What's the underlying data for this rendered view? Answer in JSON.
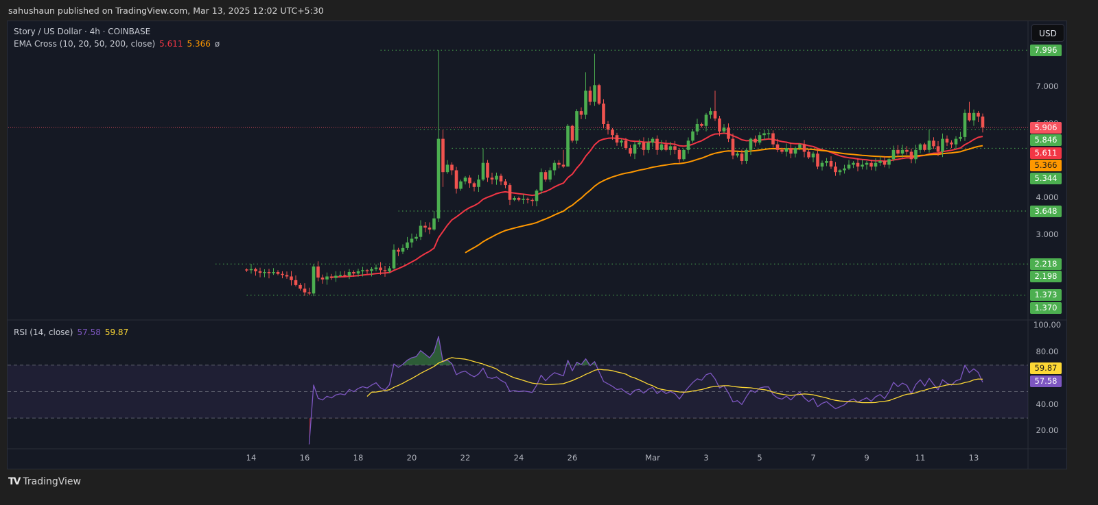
{
  "published": "sahushaun published on TradingView.com, Mar 13, 2025 12:02 UTC+5:30",
  "symbol_line": "Story / US Dollar · 4h · COINBASE",
  "ema_legend": {
    "name": "EMA Cross (10, 20, 50, 200, close)",
    "v1": "5.611",
    "v2": "5.366",
    "v3": "ø"
  },
  "rsi_legend": {
    "name": "RSI (14, close)",
    "rsi": "57.58",
    "ma": "59.87"
  },
  "currency_button": "USD",
  "footer_brand": "TradingView",
  "colors": {
    "up": "#4caf50",
    "down": "#f0534f",
    "ema_fast": "#f23645",
    "ema_slow": "#ff9800",
    "rsi": "#7e57c2",
    "rsi_ma": "#fdd835",
    "level": "#4caf50",
    "last_price": "#f7525f"
  },
  "chart_data": {
    "type": "candlestick",
    "timeframe": "4h",
    "closes": [
      2.05,
      2.08,
      2.02,
      1.98,
      2.0,
      1.97,
      2.0,
      1.95,
      1.92,
      1.88,
      1.78,
      1.65,
      1.55,
      1.45,
      1.42,
      2.15,
      1.85,
      1.8,
      1.88,
      1.84,
      1.9,
      1.92,
      1.9,
      2.0,
      1.96,
      2.02,
      2.05,
      2.03,
      2.08,
      2.12,
      2.05,
      2.02,
      2.1,
      2.6,
      2.55,
      2.65,
      2.8,
      2.9,
      2.95,
      3.25,
      3.2,
      3.15,
      3.45,
      5.6,
      4.7,
      4.9,
      4.75,
      4.25,
      4.45,
      4.55,
      4.4,
      4.3,
      4.5,
      4.95,
      4.55,
      4.5,
      4.6,
      4.45,
      4.35,
      3.95,
      4.0,
      3.95,
      3.98,
      3.95,
      3.92,
      4.2,
      4.7,
      4.5,
      4.75,
      4.95,
      4.9,
      4.85,
      5.95,
      5.55,
      6.35,
      6.25,
      6.9,
      6.6,
      7.05,
      6.55,
      6.0,
      5.85,
      5.7,
      5.5,
      5.55,
      5.35,
      5.2,
      5.45,
      5.5,
      5.3,
      5.5,
      5.6,
      5.3,
      5.45,
      5.3,
      5.4,
      5.3,
      5.05,
      5.3,
      5.55,
      5.8,
      6.0,
      5.95,
      6.25,
      6.35,
      6.15,
      5.8,
      5.9,
      5.6,
      5.15,
      5.2,
      5.0,
      5.3,
      5.6,
      5.5,
      5.7,
      5.75,
      5.75,
      5.45,
      5.3,
      5.25,
      5.35,
      5.2,
      5.35,
      5.45,
      5.25,
      5.1,
      5.2,
      4.85,
      4.95,
      5.0,
      4.85,
      4.7,
      4.75,
      4.8,
      4.9,
      4.95,
      4.85,
      4.9,
      4.95,
      4.85,
      4.95,
      5.0,
      4.9,
      5.05,
      5.3,
      5.2,
      5.3,
      5.25,
      5.05,
      5.3,
      5.45,
      5.3,
      5.55,
      5.4,
      5.25,
      5.6,
      5.5,
      5.45,
      5.6,
      5.65,
      6.3,
      6.1,
      6.3,
      6.2,
      5.906
    ],
    "high_overrides": {
      "15": 2.218,
      "33": 2.75,
      "39": 3.4,
      "42": 3.648,
      "43": 7.996,
      "44": 5.846,
      "53": 5.344,
      "71": 5.3,
      "72": 6.0,
      "76": 7.4,
      "78": 7.9,
      "105": 6.9,
      "117": 5.85,
      "153": 5.85,
      "162": 6.6
    },
    "low_overrides": {
      "14": 1.37,
      "44": 4.3,
      "72": 4.85,
      "97": 4.95,
      "132": 4.6
    },
    "first_candle_day": -0.1667,
    "price_ticks": [
      "7.000",
      "6.000",
      "4.000",
      "3.000"
    ],
    "levels": [
      {
        "price": 7.996,
        "label": "7.996",
        "start_index": 30
      },
      {
        "price": 5.846,
        "label": "5.846",
        "start_index": 38
      },
      {
        "price": 5.344,
        "label": "5.344",
        "start_index": 46
      },
      {
        "price": 3.648,
        "label": "3.648",
        "start_index": 34
      },
      {
        "price": 2.218,
        "label": "2.218",
        "start_index": -7
      },
      {
        "price": 1.373,
        "label": "1.373",
        "start_index": 0
      }
    ],
    "price_badges": [
      {
        "label": "7.996",
        "price": 7.996,
        "kind": "level"
      },
      {
        "label": "5.906",
        "price": 5.906,
        "kind": "last"
      },
      {
        "label": "5.846",
        "price": 5.846,
        "kind": "level"
      },
      {
        "label": "5.611",
        "price": 5.611,
        "kind": "ema_fast"
      },
      {
        "label": "5.366",
        "price": 5.366,
        "kind": "ema_slow"
      },
      {
        "label": "5.344",
        "price": 5.344,
        "kind": "level"
      },
      {
        "label": "3.648",
        "price": 3.648,
        "kind": "level"
      },
      {
        "label": "2.218",
        "price": 2.218,
        "kind": "level"
      },
      {
        "label": "2.198",
        "price": 2.198,
        "kind": "level"
      },
      {
        "label": "1.373",
        "price": 1.373,
        "kind": "level"
      },
      {
        "label": "1.370",
        "price": 1.37,
        "kind": "level"
      }
    ],
    "last_price": 5.906,
    "ema_periods": [
      20,
      50
    ],
    "rsi": {
      "period": 14,
      "ma_period": 14,
      "upper": 70,
      "middle": 50,
      "lower": 30,
      "ticks": [
        "100.00",
        "80.00",
        "40.00",
        "20.00"
      ],
      "badges": [
        {
          "label": "59.87",
          "kind": "ma",
          "value": 59.87
        },
        {
          "label": "57.58",
          "kind": "rsi",
          "value": 57.58
        }
      ]
    },
    "time_labels": [
      {
        "label": "14",
        "day": 0
      },
      {
        "label": "16",
        "day": 2
      },
      {
        "label": "18",
        "day": 4
      },
      {
        "label": "20",
        "day": 6
      },
      {
        "label": "22",
        "day": 8
      },
      {
        "label": "24",
        "day": 10
      },
      {
        "label": "26",
        "day": 12
      },
      {
        "label": "Mar",
        "day": 15
      },
      {
        "label": "3",
        "day": 17
      },
      {
        "label": "5",
        "day": 19
      },
      {
        "label": "7",
        "day": 21
      },
      {
        "label": "9",
        "day": 23
      },
      {
        "label": "11",
        "day": 25
      },
      {
        "label": "13",
        "day": 27
      }
    ]
  }
}
